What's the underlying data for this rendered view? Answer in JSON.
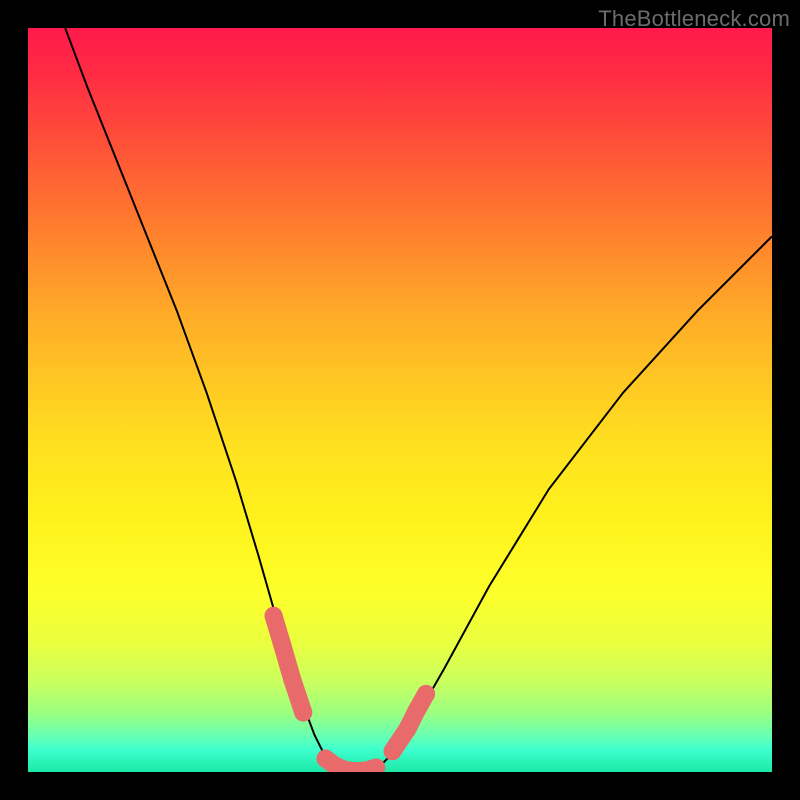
{
  "watermark": "TheBottleneck.com",
  "chart_data": {
    "type": "line",
    "title": "",
    "xlabel": "",
    "ylabel": "",
    "xlim": [
      0,
      100
    ],
    "ylim": [
      0,
      100
    ],
    "series": [
      {
        "name": "bottleneck-curve",
        "x": [
          5,
          8,
          12,
          16,
          20,
          24,
          28,
          31,
          33,
          35,
          37,
          38.5,
          40,
          42,
          44,
          46,
          47.5,
          49.5,
          52,
          56,
          62,
          70,
          80,
          90,
          100
        ],
        "y": [
          100,
          92,
          82,
          72,
          62,
          51,
          39,
          29,
          22,
          15,
          9,
          5,
          2,
          0.5,
          0,
          0,
          1,
          3,
          7,
          14,
          25,
          38,
          51,
          62,
          72
        ]
      },
      {
        "name": "marker-cluster-left",
        "x": [
          33,
          34.2,
          35.5,
          37
        ],
        "y": [
          21,
          17,
          12.5,
          8
        ]
      },
      {
        "name": "marker-cluster-bottom",
        "x": [
          40,
          41.2,
          42.5,
          44,
          45.5,
          46.8
        ],
        "y": [
          1.8,
          0.9,
          0.3,
          0.1,
          0.2,
          0.6
        ]
      },
      {
        "name": "marker-cluster-right",
        "x": [
          49,
          51,
          52.2,
          53.5
        ],
        "y": [
          2.8,
          5.8,
          8.2,
          10.5
        ]
      }
    ],
    "gradient_stops": [
      {
        "pos": 0,
        "color": "#ff1a4b"
      },
      {
        "pos": 50,
        "color": "#ffe020"
      },
      {
        "pos": 100,
        "color": "#1ce9a6"
      }
    ],
    "marker_color": "#e96a6a",
    "marker_radius": 9
  }
}
